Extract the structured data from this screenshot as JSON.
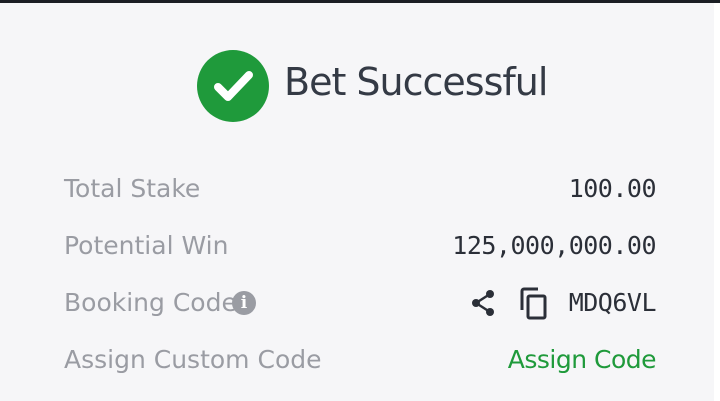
{
  "header": {
    "title": "Bet Successful",
    "icon": "check-circle-icon",
    "icon_color": "#1f9a3b"
  },
  "details": {
    "total_stake": {
      "label": "Total Stake",
      "value": "100.00"
    },
    "potential_win": {
      "label": "Potential Win",
      "value": "125,000,000.00"
    },
    "booking_code": {
      "label": "Booking Code",
      "info_icon": "info-icon",
      "share_icon": "share-icon",
      "copy_icon": "copy-icon",
      "value": "MDQ6VL"
    },
    "custom_code": {
      "label": "Assign Custom Code",
      "action_label": "Assign Code",
      "action_color": "#1f9a3b"
    }
  }
}
